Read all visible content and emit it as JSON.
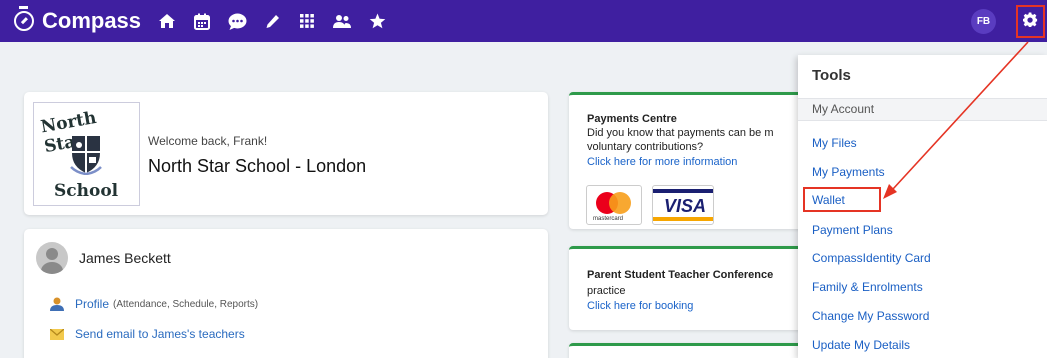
{
  "app": {
    "brand_name": "Compass",
    "user_initials": "FB",
    "brand_color": "#3f1fa0",
    "link_color": "#1a63c9",
    "highlight_color": "#e53424"
  },
  "nav": {
    "icons": [
      "home-icon",
      "calendar-icon",
      "chat-icon",
      "pencil-icon",
      "apps-grid-icon",
      "people-icon",
      "star-icon"
    ]
  },
  "school_card": {
    "crest_top": "North Star",
    "crest_bottom": "School",
    "welcome": "Welcome back, Frank!",
    "school_name": "North Star School - London"
  },
  "student_card": {
    "name": "James Beckett",
    "links": [
      {
        "label": "Profile",
        "sub": "(Attendance, Schedule, Reports)"
      },
      {
        "label": "Send email to James's teachers",
        "sub": ""
      }
    ]
  },
  "payments_card": {
    "title": "Payments Centre",
    "line1": "Did you know that payments can be m",
    "line2": "voluntary contributions?",
    "link": "Click here for more information",
    "mastercard_text": "mastercard",
    "visa_text": "VISA"
  },
  "conference_card": {
    "title": "Parent Student Teacher Conference",
    "line1": "practice",
    "link": "Click here for booking"
  },
  "tools_menu": {
    "title": "Tools",
    "section": "My Account",
    "items": [
      "My Files",
      "My Payments",
      "Wallet",
      "Payment Plans",
      "CompassIdentity Card",
      "Family & Enrolments",
      "Change My Password",
      "Update My Details"
    ],
    "highlighted_item": "Wallet"
  }
}
